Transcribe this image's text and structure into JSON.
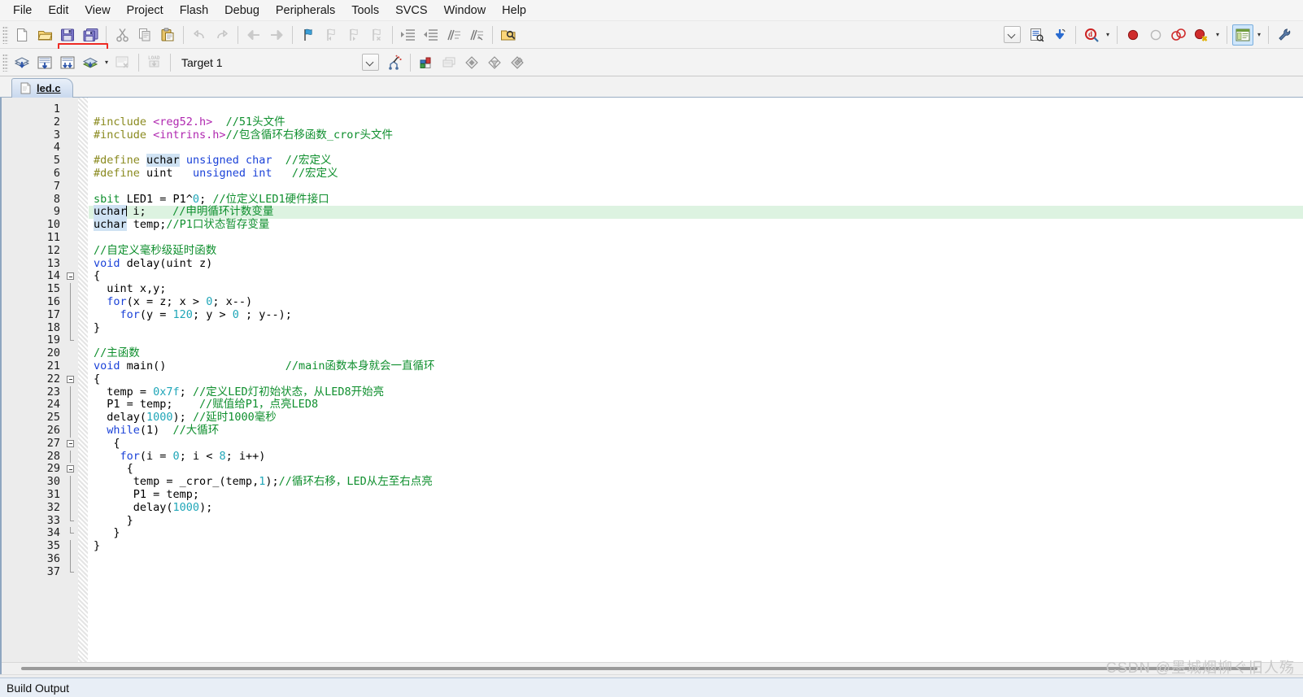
{
  "menu": {
    "items": [
      {
        "label": "File"
      },
      {
        "label": "Edit"
      },
      {
        "label": "View"
      },
      {
        "label": "Project"
      },
      {
        "label": "Flash"
      },
      {
        "label": "Debug"
      },
      {
        "label": "Peripherals"
      },
      {
        "label": "Tools"
      },
      {
        "label": "SVCS"
      },
      {
        "label": "Window"
      },
      {
        "label": "Help"
      }
    ]
  },
  "toolbar_main": {
    "icons": [
      {
        "name": "new-file-icon",
        "title": "New"
      },
      {
        "name": "open-file-icon",
        "title": "Open"
      },
      {
        "name": "save-icon",
        "title": "Save",
        "highlighted": true
      },
      {
        "name": "save-all-icon",
        "title": "Save All",
        "highlighted": true
      },
      {
        "name": "cut-icon",
        "title": "Cut"
      },
      {
        "name": "copy-icon",
        "title": "Copy"
      },
      {
        "name": "paste-icon",
        "title": "Paste"
      },
      {
        "name": "undo-icon",
        "title": "Undo"
      },
      {
        "name": "redo-icon",
        "title": "Redo"
      },
      {
        "name": "back-icon",
        "title": "Back"
      },
      {
        "name": "forward-icon",
        "title": "Forward"
      },
      {
        "name": "bookmark-toggle-icon",
        "title": "Insert/Remove Bookmark"
      },
      {
        "name": "bookmark-prev-icon",
        "title": "Previous Bookmark"
      },
      {
        "name": "bookmark-next-icon",
        "title": "Next Bookmark"
      },
      {
        "name": "bookmark-clear-icon",
        "title": "Clear All Bookmarks"
      },
      {
        "name": "indent-right-icon",
        "title": "Indent"
      },
      {
        "name": "indent-left-icon",
        "title": "Outdent"
      },
      {
        "name": "comment-icon",
        "title": "Comment Selection"
      },
      {
        "name": "uncomment-icon",
        "title": "Uncomment Selection"
      },
      {
        "name": "find-in-files-icon",
        "title": "Find in Files"
      }
    ],
    "right_icons": [
      {
        "name": "dropdown-button",
        "title": "Dropdown"
      },
      {
        "name": "configure-toolbox-icon",
        "title": "Configure"
      },
      {
        "name": "debug-start-icon",
        "title": "Start Debug"
      },
      {
        "name": "find-target-icon",
        "title": "Find"
      },
      {
        "name": "breakpoint-insert-icon",
        "title": "Insert/Remove Breakpoint"
      },
      {
        "name": "breakpoint-enable-icon",
        "title": "Enable/Disable Breakpoint"
      },
      {
        "name": "breakpoint-disable-all-icon",
        "title": "Disable All Breakpoints"
      },
      {
        "name": "breakpoint-kill-all-icon",
        "title": "Kill All Breakpoints"
      },
      {
        "name": "project-window-toggle-icon",
        "title": "Project Window",
        "active": true
      },
      {
        "name": "configure-icon",
        "title": "Configure"
      }
    ]
  },
  "toolbar_build": {
    "icons": [
      {
        "name": "translate-icon",
        "title": "Translate"
      },
      {
        "name": "build-target-icon",
        "title": "Build Target"
      },
      {
        "name": "rebuild-all-icon",
        "title": "Rebuild All Target Files"
      },
      {
        "name": "batch-build-icon",
        "title": "Batch Build"
      },
      {
        "name": "stop-build-icon",
        "title": "Stop Build"
      },
      {
        "name": "download-icon",
        "title": "Download"
      },
      {
        "name": "target-options-icon",
        "title": "Options for Target"
      },
      {
        "name": "project-manage-icon",
        "title": "Manage Project Items"
      },
      {
        "name": "components-icon",
        "title": "Components"
      },
      {
        "name": "source-browse-icon",
        "title": "Source Browse"
      },
      {
        "name": "filter-icon",
        "title": "Filter"
      },
      {
        "name": "multi-project-icon",
        "title": "Multi Project"
      }
    ],
    "target": {
      "label": "Target 1",
      "name": "target-select"
    }
  },
  "tabs": [
    {
      "label": "led.c",
      "active": true,
      "icon": "c-file-icon"
    }
  ],
  "editor": {
    "current_line": 9,
    "total_lines": 37,
    "lines": [
      {
        "n": 1,
        "fold": "none",
        "segs": []
      },
      {
        "n": 2,
        "fold": "none",
        "segs": [
          {
            "t": "#include ",
            "c": "tok-pre"
          },
          {
            "t": "<reg52.h>",
            "c": "tok-hdr"
          },
          {
            "t": "  ",
            "c": ""
          },
          {
            "t": "//51头文件",
            "c": "tok-cmt"
          }
        ]
      },
      {
        "n": 3,
        "fold": "none",
        "segs": [
          {
            "t": "#include ",
            "c": "tok-pre"
          },
          {
            "t": "<intrins.h>",
            "c": "tok-hdr"
          },
          {
            "t": "//包含循环右移函数_cror头文件",
            "c": "tok-cmt"
          }
        ]
      },
      {
        "n": 4,
        "fold": "none",
        "segs": []
      },
      {
        "n": 5,
        "fold": "none",
        "segs": [
          {
            "t": "#define ",
            "c": "tok-pre"
          },
          {
            "t": "uchar",
            "c": "tok-sel"
          },
          {
            "t": " ",
            "c": ""
          },
          {
            "t": "unsigned char",
            "c": "tok-kw"
          },
          {
            "t": "  ",
            "c": ""
          },
          {
            "t": "//宏定义",
            "c": "tok-cmt"
          }
        ]
      },
      {
        "n": 6,
        "fold": "none",
        "segs": [
          {
            "t": "#define ",
            "c": "tok-pre"
          },
          {
            "t": "uint   ",
            "c": ""
          },
          {
            "t": "unsigned int",
            "c": "tok-kw"
          },
          {
            "t": "   ",
            "c": ""
          },
          {
            "t": "//宏定义",
            "c": "tok-cmt"
          }
        ]
      },
      {
        "n": 7,
        "fold": "none",
        "segs": []
      },
      {
        "n": 8,
        "fold": "none",
        "segs": [
          {
            "t": "sbit",
            "c": "tok-cmt"
          },
          {
            "t": " LED1 = P1^",
            "c": ""
          },
          {
            "t": "0",
            "c": "tok-num"
          },
          {
            "t": "; ",
            "c": ""
          },
          {
            "t": "//位定义LED1硬件接口",
            "c": "tok-cmt"
          }
        ]
      },
      {
        "n": 9,
        "fold": "none",
        "current": true,
        "segs": [
          {
            "t": "uchar",
            "c": "tok-sel"
          },
          {
            "t": "|",
            "c": "caret"
          },
          {
            "t": " i;    ",
            "c": ""
          },
          {
            "t": "//申明循环计数变量",
            "c": "tok-cmt"
          }
        ]
      },
      {
        "n": 10,
        "fold": "none",
        "segs": [
          {
            "t": "uchar",
            "c": "tok-sel"
          },
          {
            "t": " temp;",
            "c": ""
          },
          {
            "t": "//P1口状态暂存变量",
            "c": "tok-cmt"
          }
        ]
      },
      {
        "n": 11,
        "fold": "none",
        "segs": []
      },
      {
        "n": 12,
        "fold": "none",
        "segs": [
          {
            "t": "//自定义毫秒级延时函数",
            "c": "tok-cmt"
          }
        ]
      },
      {
        "n": 13,
        "fold": "none",
        "segs": [
          {
            "t": "void",
            "c": "tok-kw"
          },
          {
            "t": " delay(uint z)",
            "c": ""
          }
        ]
      },
      {
        "n": 14,
        "fold": "box",
        "segs": [
          {
            "t": "{",
            "c": ""
          }
        ]
      },
      {
        "n": 15,
        "fold": "line",
        "segs": [
          {
            "t": "  uint x,y;",
            "c": ""
          }
        ]
      },
      {
        "n": 16,
        "fold": "line",
        "segs": [
          {
            "t": "  ",
            "c": ""
          },
          {
            "t": "for",
            "c": "tok-kw"
          },
          {
            "t": "(x = z; x > ",
            "c": ""
          },
          {
            "t": "0",
            "c": "tok-num"
          },
          {
            "t": "; x--)",
            "c": ""
          }
        ]
      },
      {
        "n": 17,
        "fold": "line",
        "segs": [
          {
            "t": "    ",
            "c": ""
          },
          {
            "t": "for",
            "c": "tok-kw"
          },
          {
            "t": "(y = ",
            "c": ""
          },
          {
            "t": "120",
            "c": "tok-num"
          },
          {
            "t": "; y > ",
            "c": ""
          },
          {
            "t": "0",
            "c": "tok-num"
          },
          {
            "t": " ; y--);",
            "c": ""
          }
        ]
      },
      {
        "n": 18,
        "fold": "line",
        "segs": [
          {
            "t": "}",
            "c": ""
          }
        ]
      },
      {
        "n": 19,
        "fold": "end",
        "segs": []
      },
      {
        "n": 20,
        "fold": "none",
        "segs": [
          {
            "t": "//主函数",
            "c": "tok-cmt"
          }
        ]
      },
      {
        "n": 21,
        "fold": "none",
        "segs": [
          {
            "t": "void",
            "c": "tok-kw"
          },
          {
            "t": " main()                  ",
            "c": ""
          },
          {
            "t": "//main函数本身就会一直循环",
            "c": "tok-cmt"
          }
        ]
      },
      {
        "n": 22,
        "fold": "box",
        "segs": [
          {
            "t": "{",
            "c": ""
          }
        ]
      },
      {
        "n": 23,
        "fold": "line",
        "segs": [
          {
            "t": "  temp = ",
            "c": ""
          },
          {
            "t": "0x7f",
            "c": "tok-num"
          },
          {
            "t": "; ",
            "c": ""
          },
          {
            "t": "//定义LED灯初始状态，从LED8开始亮",
            "c": "tok-cmt"
          }
        ]
      },
      {
        "n": 24,
        "fold": "line",
        "segs": [
          {
            "t": "  P1 = temp;    ",
            "c": ""
          },
          {
            "t": "//赋值给P1，点亮LED8",
            "c": "tok-cmt"
          }
        ]
      },
      {
        "n": 25,
        "fold": "line",
        "segs": [
          {
            "t": "  delay(",
            "c": ""
          },
          {
            "t": "1000",
            "c": "tok-num"
          },
          {
            "t": "); ",
            "c": ""
          },
          {
            "t": "//延时1000毫秒",
            "c": "tok-cmt"
          }
        ]
      },
      {
        "n": 26,
        "fold": "line",
        "segs": [
          {
            "t": "  ",
            "c": ""
          },
          {
            "t": "while",
            "c": "tok-kw"
          },
          {
            "t": "(1)  ",
            "c": ""
          },
          {
            "t": "//大循环",
            "c": "tok-cmt"
          }
        ]
      },
      {
        "n": 27,
        "fold": "box2",
        "segs": [
          {
            "t": "   {",
            "c": ""
          }
        ]
      },
      {
        "n": 28,
        "fold": "line2",
        "segs": [
          {
            "t": "    ",
            "c": ""
          },
          {
            "t": "for",
            "c": "tok-kw"
          },
          {
            "t": "(i = ",
            "c": ""
          },
          {
            "t": "0",
            "c": "tok-num"
          },
          {
            "t": "; i < ",
            "c": ""
          },
          {
            "t": "8",
            "c": "tok-num"
          },
          {
            "t": "; i++)",
            "c": ""
          }
        ]
      },
      {
        "n": 29,
        "fold": "box3",
        "segs": [
          {
            "t": "     {",
            "c": ""
          }
        ]
      },
      {
        "n": 30,
        "fold": "line3",
        "segs": [
          {
            "t": "      temp = _cror_(temp,",
            "c": ""
          },
          {
            "t": "1",
            "c": "tok-num"
          },
          {
            "t": ");",
            "c": ""
          },
          {
            "t": "//循环右移，LED从左至右点亮",
            "c": "tok-cmt"
          }
        ]
      },
      {
        "n": 31,
        "fold": "line3",
        "segs": [
          {
            "t": "      P1 = temp;",
            "c": ""
          }
        ]
      },
      {
        "n": 32,
        "fold": "line3",
        "segs": [
          {
            "t": "      delay(",
            "c": ""
          },
          {
            "t": "1000",
            "c": "tok-num"
          },
          {
            "t": ");",
            "c": ""
          }
        ]
      },
      {
        "n": 33,
        "fold": "end3",
        "segs": [
          {
            "t": "     }",
            "c": ""
          }
        ]
      },
      {
        "n": 34,
        "fold": "end2",
        "segs": [
          {
            "t": "   }",
            "c": ""
          }
        ]
      },
      {
        "n": 35,
        "fold": "line",
        "segs": [
          {
            "t": "}",
            "c": ""
          }
        ]
      },
      {
        "n": 36,
        "fold": "line",
        "segs": []
      },
      {
        "n": 37,
        "fold": "end",
        "segs": []
      }
    ]
  },
  "build_output": {
    "title": "Build Output"
  },
  "watermark": {
    "text": "CSDN @墨城烟柳ぐ旧人殇"
  },
  "colors": {
    "accent_red": "#ee2b24",
    "current_line": "#ddf3e1",
    "selection": "#cfe2f3",
    "comment": "#0f8f2e",
    "keyword": "#1b42d8",
    "preproc": "#8a8a1f",
    "header": "#b028b0",
    "number": "#1fa6b8"
  }
}
